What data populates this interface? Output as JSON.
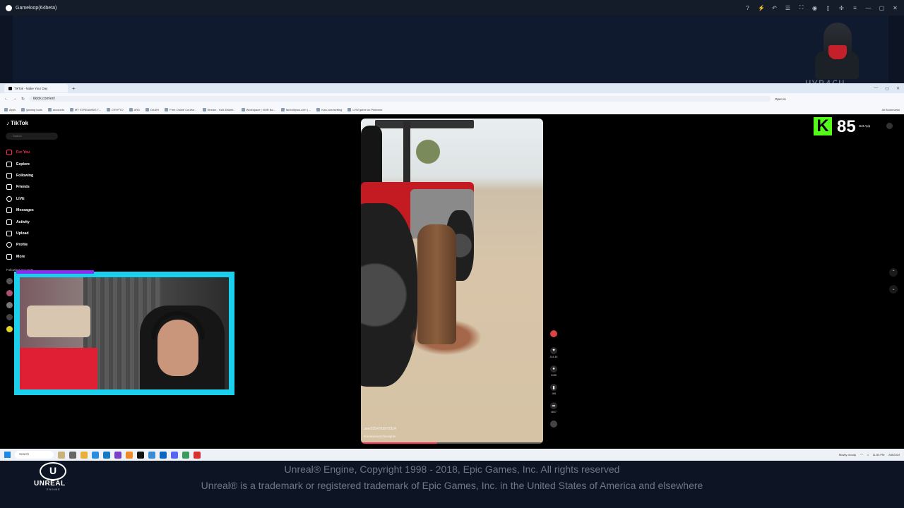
{
  "gameloop": {
    "title": "Gameloop(64beta)",
    "controls": [
      "?",
      "⚡",
      "↶",
      "☰",
      "⛶",
      "◉",
      "▯",
      "✣",
      "≡",
      "—",
      "▢",
      "✕"
    ]
  },
  "overlay": {
    "avatar_tag": "HYB4CH",
    "kick_count": "85"
  },
  "browser": {
    "tab_label": "TikTok - Make Your Day",
    "url": "tiktok.com/en/",
    "open_in": "Open in",
    "bookmarks": [
      "Apps",
      "gaming tools",
      "accounts",
      "MY STREAMING T...",
      "CRYPTO",
      "ARD",
      "DASHI",
      "Free Online Course...",
      "Stream - Kick Dashb...",
      "Workspace | XMR Ba...",
      "fanbolliplus.com | ...",
      "Kick.com/setting",
      "LVW game on Pinterest"
    ],
    "all_bookmarks": "All Bookmarks"
  },
  "tiktok": {
    "logo": "TikTok",
    "search_placeholder": "Search",
    "nav": [
      {
        "label": "For You",
        "icon": "home-icon"
      },
      {
        "label": "Explore",
        "icon": "compass-icon"
      },
      {
        "label": "Following",
        "icon": "following-icon"
      },
      {
        "label": "Friends",
        "icon": "friends-icon"
      },
      {
        "label": "LIVE",
        "icon": "live-icon"
      },
      {
        "label": "Messages",
        "icon": "messages-icon"
      },
      {
        "label": "Activity",
        "icon": "activity-icon"
      },
      {
        "label": "Upload",
        "icon": "upload-icon"
      },
      {
        "label": "Profile",
        "icon": "profile-icon"
      },
      {
        "label": "More",
        "icon": "more-icon"
      }
    ],
    "following_accounts": "Following accounts",
    "get_app": "Get App",
    "video": {
      "username": "user5354763972314",
      "hashtags": "#creatorsearchinsights",
      "progress": 0.42
    },
    "actions": {
      "likes": "314.3K",
      "comments": "3155",
      "saves": "168",
      "shares": "4847"
    }
  },
  "taskbar": {
    "search_placeholder": "Search",
    "weather": "Mostly cloudy",
    "time": "11:50 PM",
    "date": "8/8/2024"
  },
  "unreal": {
    "logo_mark": "U",
    "word": "UNREAL",
    "sub": "ENGINE",
    "line1": "Unreal® Engine, Copyright 1998 - 2018, Epic Games, Inc.  All rights reserved",
    "line2": "Unreal® is a trademark or registered trademark of Epic Games, Inc. in the United States of America and elsewhere"
  },
  "colors": {
    "tiktok_accent": "#fe2c55",
    "webcam_border": "#1bd0ec",
    "kick_green": "#53fc18"
  }
}
